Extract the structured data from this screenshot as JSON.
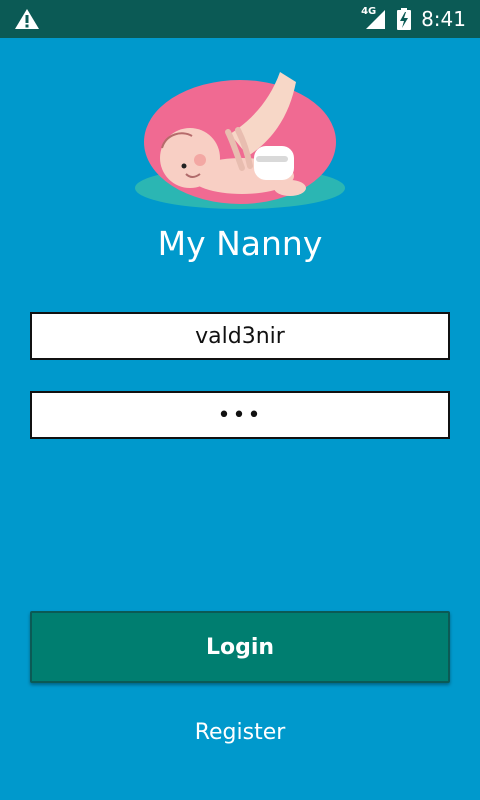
{
  "statusbar": {
    "network_label": "4G",
    "time": "8:41"
  },
  "icons": {
    "warning": "warning-icon",
    "signal": "signal-icon",
    "battery": "battery-charging-icon"
  },
  "app": {
    "title": "My Nanny"
  },
  "form": {
    "username_value": "vald3nir",
    "password_mask": "•••",
    "login_label": "Login",
    "register_label": "Register"
  },
  "colors": {
    "background": "#0099CC",
    "statusbar": "#0B5A55",
    "button": "#007E70",
    "logo_pink": "#F06A92",
    "logo_teal": "#2BB6B3"
  }
}
